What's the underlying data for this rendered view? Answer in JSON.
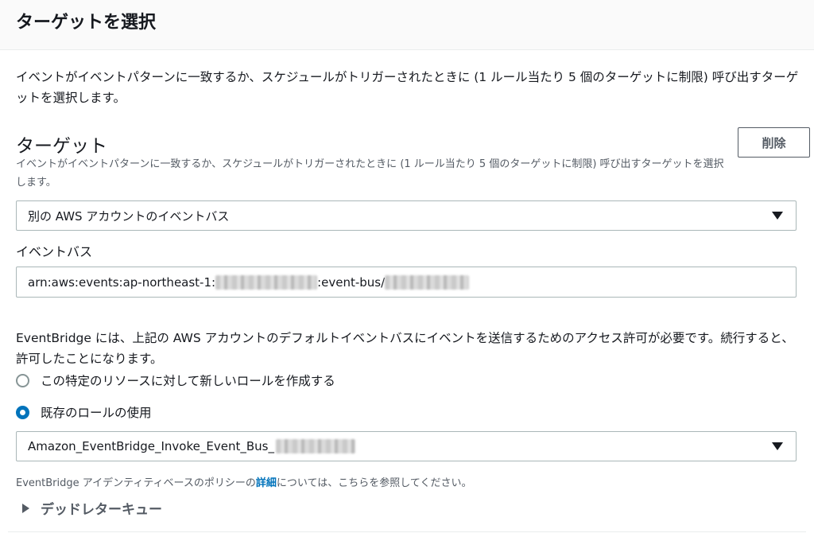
{
  "panel": {
    "title": "ターゲットを選択",
    "intro": "イベントがイベントパターンに一致するか、スケジュールがトリガーされたときに (1 ルール当たり 5 個のターゲットに制限) 呼び出すターゲットを選択します。"
  },
  "target": {
    "heading": "ターゲット",
    "description": "イベントがイベントパターンに一致するか、スケジュールがトリガーされたときに (1 ルール当たり 5 個のターゲットに制限) 呼び出すターゲットを選択します。",
    "delete_label": "削除",
    "type_selected": "別の AWS アカウントのイベントバス"
  },
  "event_bus": {
    "label": "イベントバス",
    "value_prefix": "arn:aws:events:ap-northeast-1:",
    "value_middle": ":event-bus/"
  },
  "permission": {
    "text": "EventBridge には、上記の AWS アカウントのデフォルトイベントバスにイベントを送信するためのアクセス許可が必要です。続行すると、許可したことになります。",
    "options": [
      {
        "label": "この特定のリソースに対して新しいロールを作成する",
        "selected": false
      },
      {
        "label": "既存のロールの使用",
        "selected": true
      }
    ],
    "role_selected_prefix": "Amazon_EventBridge_Invoke_Event_Bus_"
  },
  "policy_note": {
    "before": "EventBridge アイデンティティベースのポリシーの",
    "link": "詳細",
    "after": "については、こちらを参照してください。"
  },
  "dlq": {
    "label": "デッドレターキュー"
  },
  "colors": {
    "accent": "#0073bb",
    "text": "#16191f",
    "secondary_text": "#545b64",
    "border": "#aab7b8"
  }
}
